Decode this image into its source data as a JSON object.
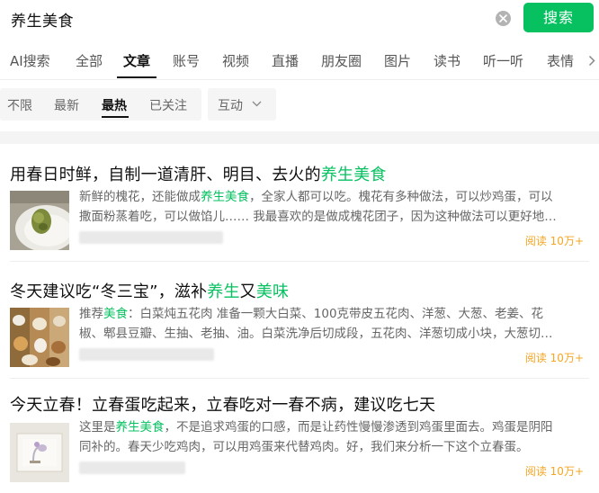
{
  "search": {
    "query": "养生美食",
    "button_label": "搜索"
  },
  "tabs": [
    {
      "label": "AI搜索",
      "active": false
    },
    {
      "label": "全部",
      "active": false
    },
    {
      "label": "文章",
      "active": true
    },
    {
      "label": "账号",
      "active": false
    },
    {
      "label": "视频",
      "active": false
    },
    {
      "label": "直播",
      "active": false
    },
    {
      "label": "朋友圈",
      "active": false
    },
    {
      "label": "图片",
      "active": false
    },
    {
      "label": "读书",
      "active": false
    },
    {
      "label": "听一听",
      "active": false
    },
    {
      "label": "表情",
      "active": false
    }
  ],
  "filters": {
    "items": [
      {
        "label": "不限",
        "active": false
      },
      {
        "label": "最新",
        "active": false
      },
      {
        "label": "最热",
        "active": true
      },
      {
        "label": "已关注",
        "active": false
      }
    ],
    "interact_label": "互动"
  },
  "results": [
    {
      "title_parts": [
        {
          "text": "用春日时鲜，自制一道清肝、明目、去火的",
          "hl": false
        },
        {
          "text": "养生美食",
          "hl": true
        }
      ],
      "summary_lines": [
        [
          {
            "text": "新鲜的槐花，还能做成",
            "hl": false
          },
          {
            "text": "养生美食",
            "hl": true
          },
          {
            "text": "，全家人都可以吃。槐花有多种做法，可以炒鸡蛋，可以",
            "hl": false
          }
        ],
        [
          {
            "text": "撒面粉蒸着吃，可以做馅儿…… 我最喜欢的是做成槐花团子，因为这种做法可以更好地…",
            "hl": false
          }
        ]
      ],
      "read_count": "阅读 10万+"
    },
    {
      "title_parts": [
        {
          "text": "冬天建议吃“冬三宝”，滋补",
          "hl": false
        },
        {
          "text": "养生",
          "hl": true
        },
        {
          "text": "又",
          "hl": false
        },
        {
          "text": "美味",
          "hl": true
        }
      ],
      "summary_lines": [
        [
          {
            "text": "推荐",
            "hl": false
          },
          {
            "text": "美食",
            "hl": true
          },
          {
            "text": "：白菜炖五花肉 准备一颗大白菜、100克带皮五花肉、洋葱、大葱、老姜、花",
            "hl": false
          }
        ],
        [
          {
            "text": "椒、郫县豆瓣、生抽、老抽、油。白菜洗净后切成段，五花肉、洋葱切成小块，大葱切…",
            "hl": false
          }
        ]
      ],
      "read_count": "阅读 10万+"
    },
    {
      "title_parts": [
        {
          "text": "今天立春！立春蛋吃起来，立春吃对一春不病，建议吃七天",
          "hl": false
        }
      ],
      "summary_lines": [
        [
          {
            "text": "这里是",
            "hl": false
          },
          {
            "text": "养生美食",
            "hl": true
          },
          {
            "text": "，不是追求鸡蛋的口感，而是让药性慢慢渗透到鸡蛋里面去。鸡蛋是阴阳",
            "hl": false
          }
        ],
        [
          {
            "text": "同补的。春天少吃鸡肉，可以用鸡蛋来代替鸡肉。好，我们来分析一下这个立春蛋。",
            "hl": false
          }
        ]
      ],
      "read_count": "阅读 10万+"
    }
  ],
  "colors": {
    "accent": "#07c160",
    "read_count": "#f5a623"
  }
}
